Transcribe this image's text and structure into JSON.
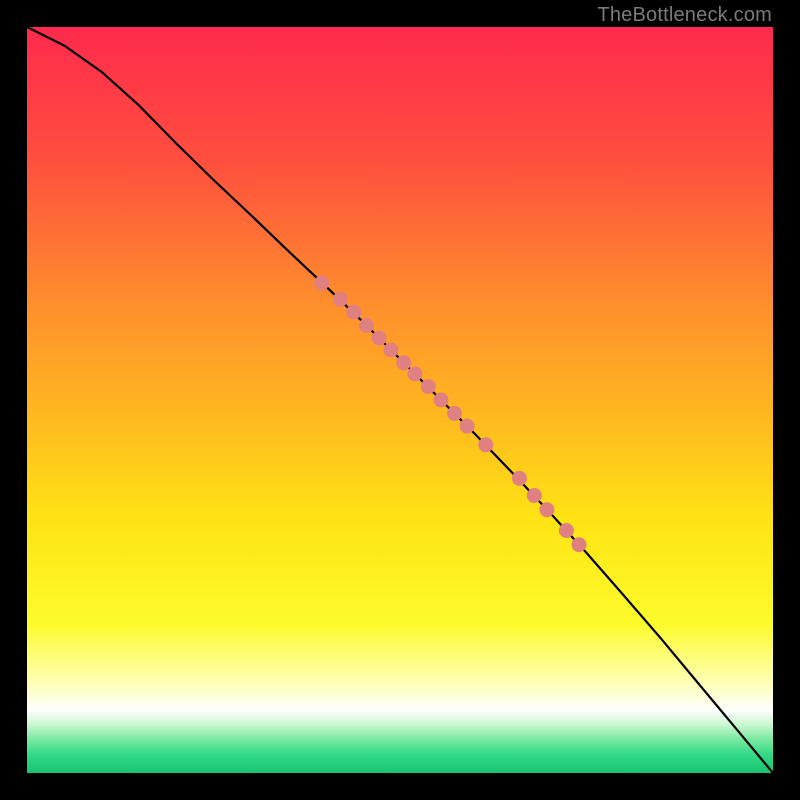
{
  "watermark": "TheBottleneck.com",
  "colors": {
    "frame_bg": "#000000",
    "watermark": "#7b7b7b",
    "curve": "#000000",
    "dot": "#e08080",
    "gradient_stops": [
      {
        "pos": 0.0,
        "color": "#ff2a4d"
      },
      {
        "pos": 0.18,
        "color": "#ff4f3e"
      },
      {
        "pos": 0.36,
        "color": "#ff8b2e"
      },
      {
        "pos": 0.52,
        "color": "#ffb81f"
      },
      {
        "pos": 0.66,
        "color": "#ffe314"
      },
      {
        "pos": 0.8,
        "color": "#fdfb2b"
      },
      {
        "pos": 0.885,
        "color": "#feffc0"
      },
      {
        "pos": 0.915,
        "color": "#ffffff"
      },
      {
        "pos": 0.935,
        "color": "#caf7d0"
      },
      {
        "pos": 0.955,
        "color": "#7ae9a0"
      },
      {
        "pos": 0.975,
        "color": "#33d987"
      },
      {
        "pos": 1.0,
        "color": "#17c471"
      }
    ]
  },
  "chart_data": {
    "type": "line",
    "title": "",
    "xlabel": "",
    "ylabel": "",
    "xlim": [
      0,
      1
    ],
    "ylim": [
      0,
      1
    ],
    "curve": [
      {
        "x": 0.0,
        "y": 1.0
      },
      {
        "x": 0.05,
        "y": 0.975
      },
      {
        "x": 0.1,
        "y": 0.94
      },
      {
        "x": 0.15,
        "y": 0.895
      },
      {
        "x": 0.2,
        "y": 0.844
      },
      {
        "x": 0.25,
        "y": 0.795
      },
      {
        "x": 0.3,
        "y": 0.748
      },
      {
        "x": 0.35,
        "y": 0.7
      },
      {
        "x": 0.4,
        "y": 0.653
      },
      {
        "x": 0.45,
        "y": 0.605
      },
      {
        "x": 0.5,
        "y": 0.555
      },
      {
        "x": 0.55,
        "y": 0.505
      },
      {
        "x": 0.6,
        "y": 0.455
      },
      {
        "x": 0.65,
        "y": 0.403
      },
      {
        "x": 0.7,
        "y": 0.35
      },
      {
        "x": 0.75,
        "y": 0.295
      },
      {
        "x": 0.8,
        "y": 0.238
      },
      {
        "x": 0.85,
        "y": 0.18
      },
      {
        "x": 0.9,
        "y": 0.12
      },
      {
        "x": 0.95,
        "y": 0.06
      },
      {
        "x": 1.0,
        "y": 0.0
      }
    ],
    "series": [
      {
        "name": "highlighted-points",
        "points": [
          {
            "x": 0.395,
            "y": 0.657
          },
          {
            "x": 0.42,
            "y": 0.635
          },
          {
            "x": 0.438,
            "y": 0.618
          },
          {
            "x": 0.455,
            "y": 0.6
          },
          {
            "x": 0.472,
            "y": 0.583
          },
          {
            "x": 0.488,
            "y": 0.567
          },
          {
            "x": 0.505,
            "y": 0.55
          },
          {
            "x": 0.52,
            "y": 0.535
          },
          {
            "x": 0.538,
            "y": 0.518
          },
          {
            "x": 0.555,
            "y": 0.5
          },
          {
            "x": 0.573,
            "y": 0.482
          },
          {
            "x": 0.59,
            "y": 0.465
          },
          {
            "x": 0.615,
            "y": 0.44
          },
          {
            "x": 0.66,
            "y": 0.395
          },
          {
            "x": 0.68,
            "y": 0.372
          },
          {
            "x": 0.697,
            "y": 0.353
          },
          {
            "x": 0.723,
            "y": 0.325
          },
          {
            "x": 0.74,
            "y": 0.306
          }
        ]
      }
    ]
  }
}
